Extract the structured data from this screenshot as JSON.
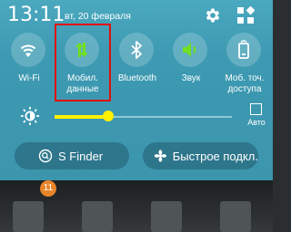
{
  "status": {
    "time": "13:11",
    "date": "вт, 20 февраля"
  },
  "quick_toggles": [
    {
      "label": "Wi-Fi",
      "icon": "wifi-icon",
      "active": false
    },
    {
      "label": "Мобил. данные",
      "icon": "mobile-data-icon",
      "active": true
    },
    {
      "label": "Bluetooth",
      "icon": "bluetooth-icon",
      "active": false
    },
    {
      "label": "Звук",
      "icon": "sound-icon",
      "active": true
    },
    {
      "label": "Моб. точ. доступа",
      "icon": "hotspot-icon",
      "active": false
    }
  ],
  "brightness": {
    "level": 0.3,
    "auto_label": "Авто",
    "auto_checked": false
  },
  "buttons": {
    "s_finder": "S Finder",
    "quick_connect": "Быстрое подкл."
  },
  "home": {
    "badge_count": "11"
  },
  "colors": {
    "panel": "#3d9ab2",
    "active_icon": "#6fe020",
    "slider": "#fff200",
    "highlight": "#e01010"
  }
}
